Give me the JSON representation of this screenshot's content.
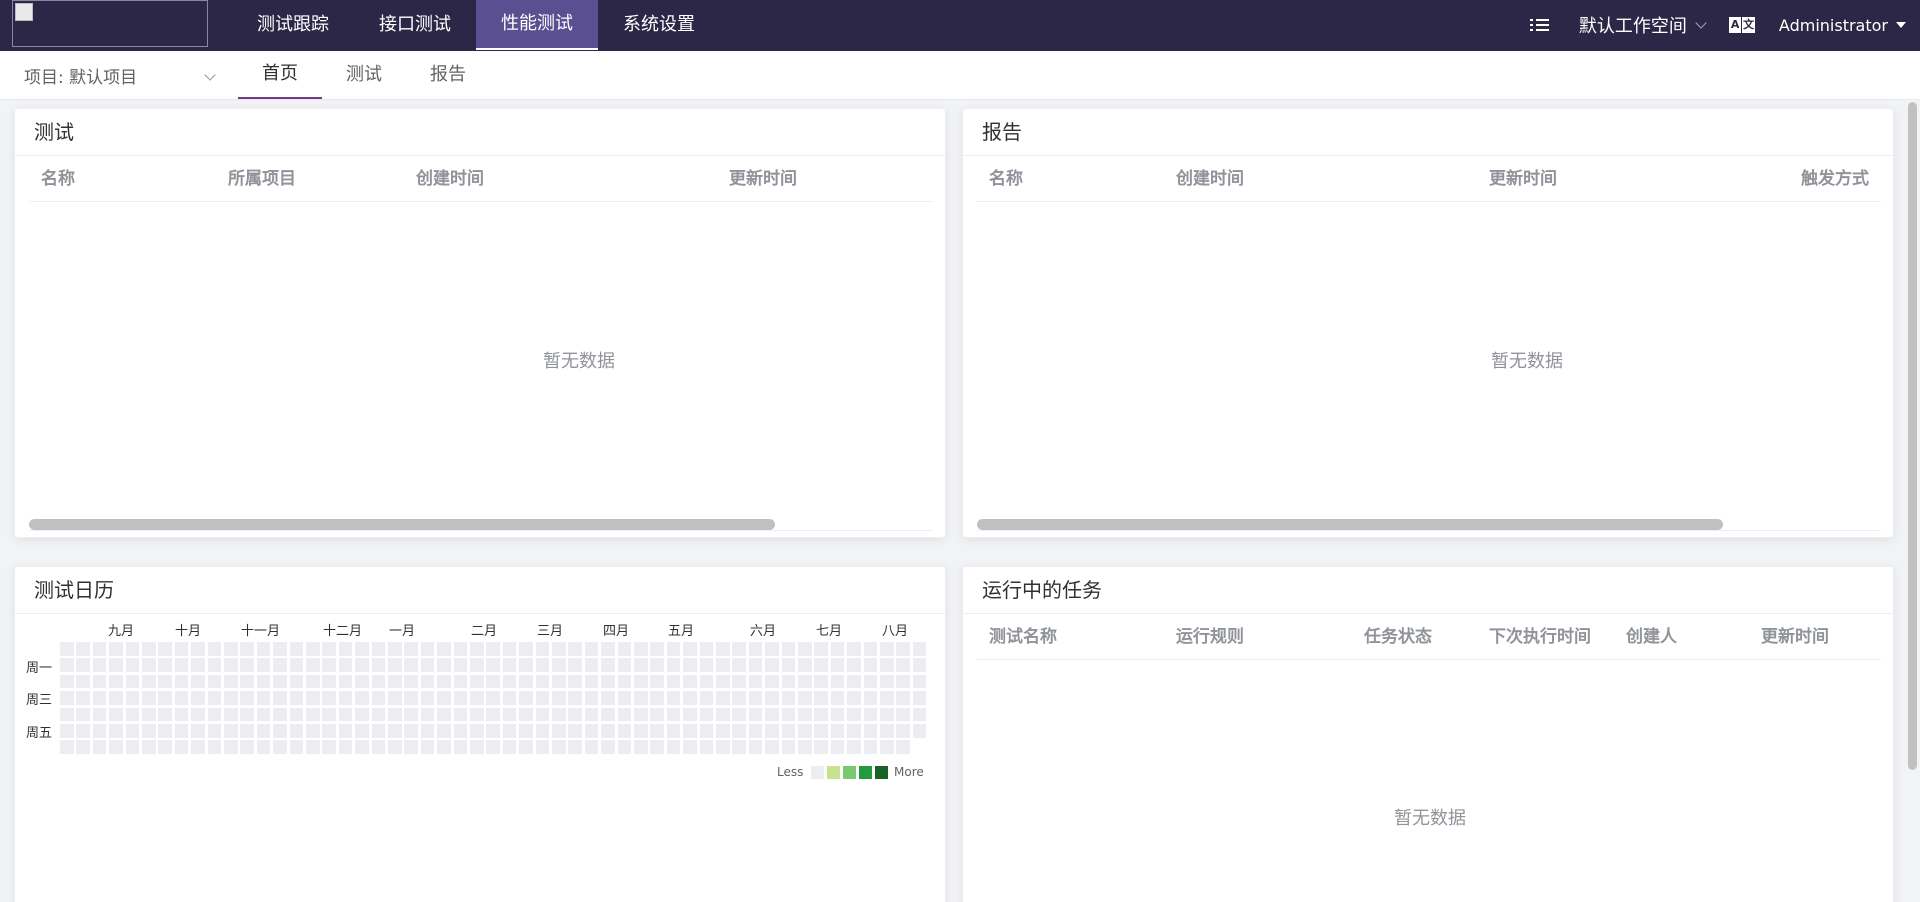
{
  "topnav": {
    "items": [
      {
        "label": "测试跟踪",
        "active": false
      },
      {
        "label": "接口测试",
        "active": false
      },
      {
        "label": "性能测试",
        "active": true
      },
      {
        "label": "系统设置",
        "active": false
      }
    ],
    "workspace": "默认工作空间",
    "language_icon": "translate-icon",
    "user": "Administrator"
  },
  "subnav": {
    "project": "项目: 默认项目",
    "tabs": [
      {
        "label": "首页",
        "active": true
      },
      {
        "label": "测试",
        "active": false
      },
      {
        "label": "报告",
        "active": false
      }
    ]
  },
  "tests_card": {
    "title": "测试",
    "columns": [
      "名称",
      "所属项目",
      "创建时间",
      "更新时间"
    ],
    "empty": "暂无数据"
  },
  "reports_card": {
    "title": "报告",
    "columns": [
      "名称",
      "创建时间",
      "更新时间",
      "触发方式"
    ],
    "empty": "暂无数据"
  },
  "calendar_card": {
    "title": "测试日历",
    "months": [
      "九月",
      "十月",
      "十一月",
      "十二月",
      "一月",
      "二月",
      "三月",
      "四月",
      "五月",
      "六月",
      "七月",
      "八月"
    ],
    "days": [
      "周一",
      "周三",
      "周五"
    ],
    "legend_less": "Less",
    "legend_more": "More",
    "colors": {
      "empty": "#ebedf0",
      "l1": "#c6e48b",
      "l2": "#7bc96f",
      "l3": "#239a3b",
      "l4": "#196127"
    }
  },
  "tasks_card": {
    "title": "运行中的任务",
    "columns": [
      "测试名称",
      "运行规则",
      "任务状态",
      "下次执行时间",
      "创建人",
      "更新时间"
    ],
    "empty": "暂无数据"
  },
  "colors": {
    "header_bg": "#2d2747",
    "active_tab_bg": "#5a4f91",
    "accent": "#783887"
  }
}
